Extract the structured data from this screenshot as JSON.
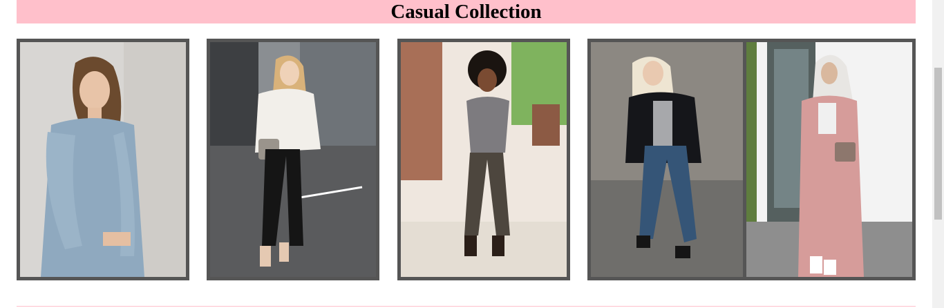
{
  "section": {
    "title": "Casual Collection"
  },
  "gallery": {
    "photos": [
      {
        "name": "photo-denim-jacket",
        "subject": "woman in light denim shirt jacket against concrete wall"
      },
      {
        "name": "photo-white-sweater",
        "subject": "woman in white knit sweater and ripped black jeans on street"
      },
      {
        "name": "photo-gray-tee",
        "subject": "woman in gray tee and olive joggers on sidewalk"
      },
      {
        "name": "photo-black-blazer",
        "subject": "woman in black blazer and distressed blue jeans"
      },
      {
        "name": "photo-pink-duster",
        "subject": "woman in pink duster coat and white sneakers"
      }
    ]
  },
  "colors": {
    "banner": "#ffc0cb",
    "frame": "#555555"
  }
}
